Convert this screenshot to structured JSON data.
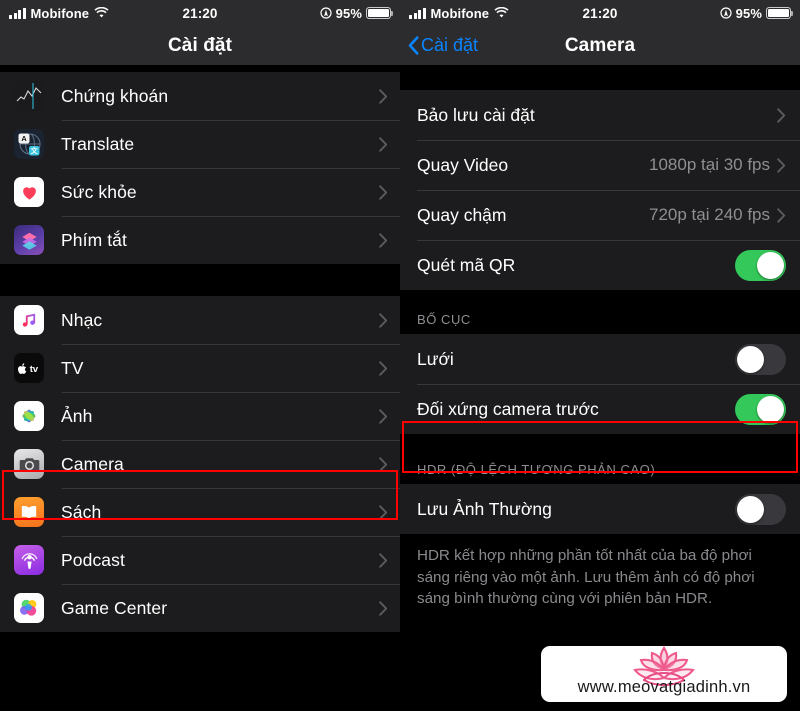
{
  "status_bar": {
    "carrier": "Mobifone",
    "time": "21:20",
    "battery_pct": "95%",
    "icons": [
      "signal-bars-icon",
      "wifi-icon",
      "location-arrow-icon",
      "battery-icon"
    ]
  },
  "colors": {
    "accent_blue": "#0a84ff",
    "toggle_on_green": "#34c759",
    "toggle_off_gray": "#39393d",
    "highlight_red": "#ff0000",
    "list_bg": "#1c1c1e",
    "bar_bg": "#2c2c2e",
    "secondary_text": "#8e8e93"
  },
  "left_pane": {
    "nav_title": "Cài đặt",
    "groups": [
      {
        "items": [
          {
            "label": "Chứng khoán",
            "icon": "stocks-app-icon",
            "accessory": "chevron"
          },
          {
            "label": "Translate",
            "icon": "translate-app-icon",
            "accessory": "chevron"
          },
          {
            "label": "Sức khỏe",
            "icon": "health-app-icon",
            "accessory": "chevron"
          },
          {
            "label": "Phím tắt",
            "icon": "shortcuts-app-icon",
            "accessory": "chevron"
          }
        ]
      },
      {
        "items": [
          {
            "label": "Nhạc",
            "icon": "music-app-icon",
            "accessory": "chevron"
          },
          {
            "label": "TV",
            "icon": "tv-app-icon",
            "accessory": "chevron"
          },
          {
            "label": "Ảnh",
            "icon": "photos-app-icon",
            "accessory": "chevron"
          },
          {
            "label": "Camera",
            "icon": "camera-app-icon",
            "accessory": "chevron",
            "highlighted": true
          },
          {
            "label": "Sách",
            "icon": "books-app-icon",
            "accessory": "chevron"
          },
          {
            "label": "Podcast",
            "icon": "podcast-app-icon",
            "accessory": "chevron"
          },
          {
            "label": "Game Center",
            "icon": "gamecenter-app-icon",
            "accessory": "chevron"
          }
        ]
      }
    ]
  },
  "right_pane": {
    "back_label": "Cài đặt",
    "nav_title": "Camera",
    "group1": [
      {
        "label": "Bảo lưu cài đặt",
        "value": "",
        "accessory": "chevron"
      },
      {
        "label": "Quay Video",
        "value": "1080p tại 30 fps",
        "accessory": "chevron"
      },
      {
        "label": "Quay chậm",
        "value": "720p tại 240 fps",
        "accessory": "chevron"
      },
      {
        "label": "Quét mã QR",
        "value": "",
        "accessory": "toggle",
        "toggle": "on"
      }
    ],
    "section_layout_header": "BỐ CỤC",
    "group2": [
      {
        "label": "Lưới",
        "accessory": "toggle",
        "toggle": "off"
      },
      {
        "label": "Đối xứng camera trước",
        "accessory": "toggle",
        "toggle": "on",
        "highlighted": true
      }
    ],
    "section_hdr_header": "HDR (ĐỘ LỆCH TƯƠNG PHẢN CAO)",
    "group3": [
      {
        "label": "Lưu Ảnh Thường",
        "accessory": "toggle",
        "toggle": "off"
      }
    ],
    "hdr_footer": "HDR kết hợp những phần tốt nhất của ba độ phơi sáng riêng vào một ảnh. Lưu thêm ảnh có độ phơi sáng bình thường cùng với phiên bản HDR."
  },
  "watermark": {
    "url": "www.meovatgiadinh.vn",
    "logo": "lotus-flower-logo"
  }
}
